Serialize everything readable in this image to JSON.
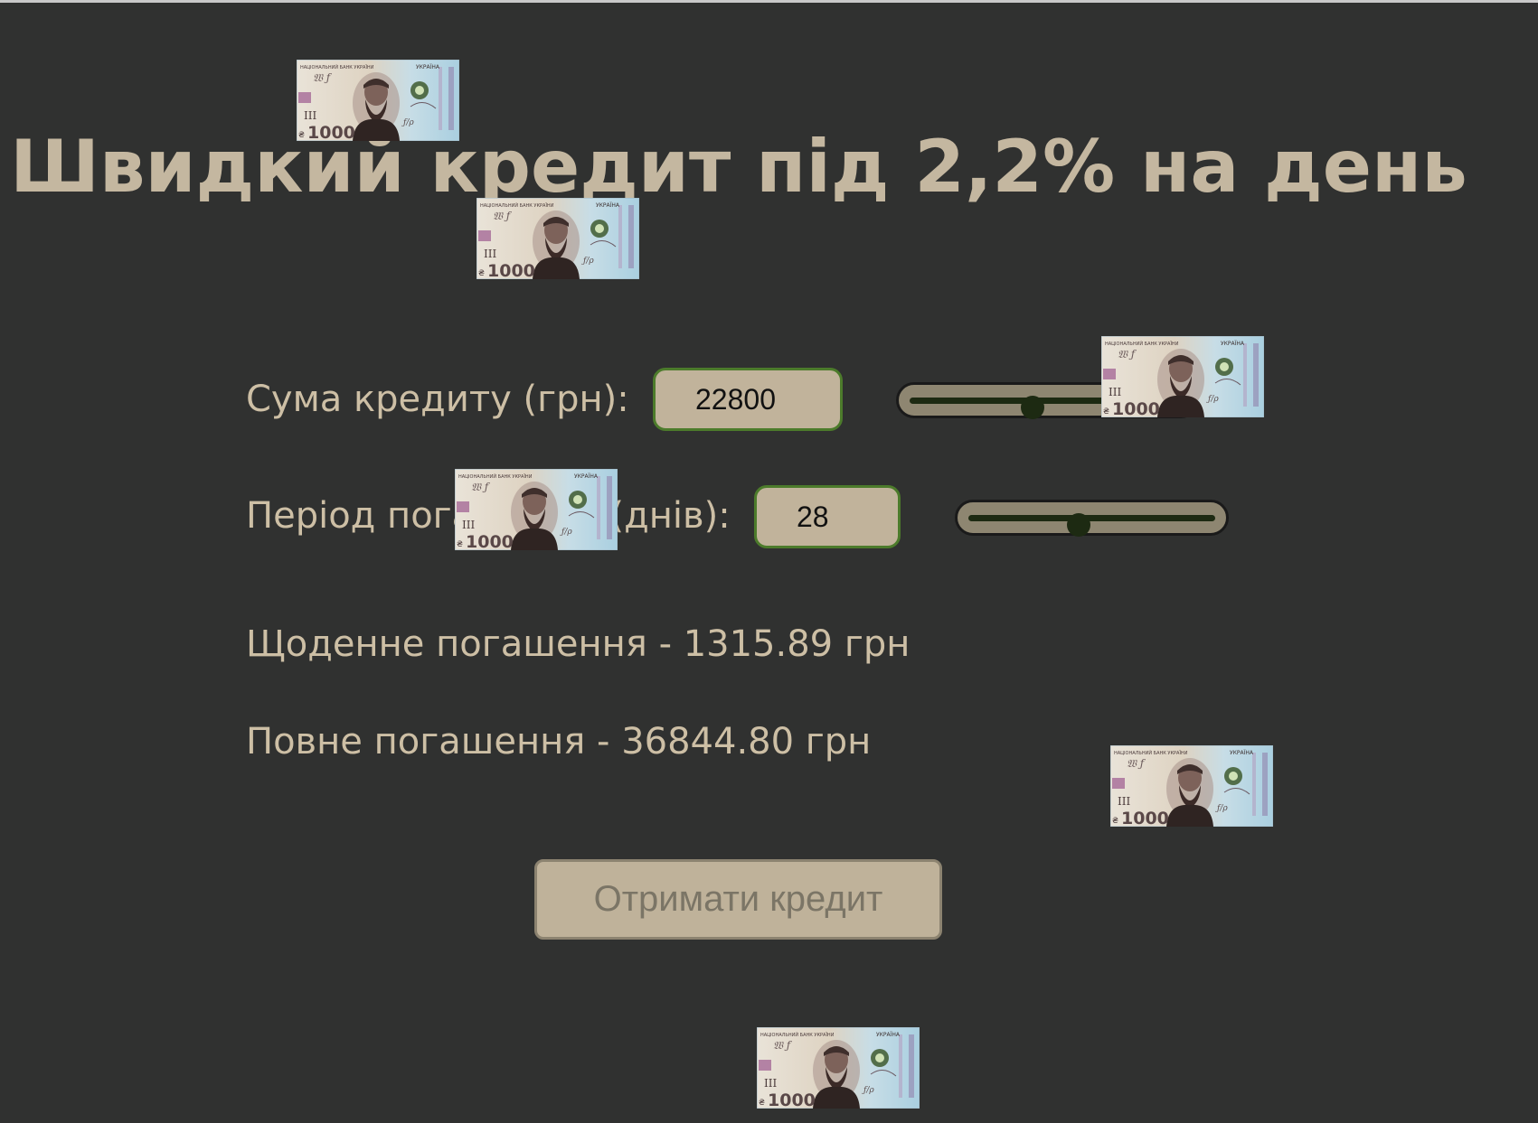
{
  "title": "Швидкий кредит під 2,2% на день",
  "loan_amount": {
    "label": "Сума кредиту (грн):",
    "value": "22800",
    "slider_fraction": 0.45
  },
  "period": {
    "label": "Період погашення (днів):",
    "value": "28",
    "slider_fraction": 0.45
  },
  "results": {
    "daily": "Щоденне погашення - 1315.89 грн",
    "total": "Повне погашення - 36844.80 грн"
  },
  "cta": {
    "label": "Отримати кредит"
  },
  "banknote": {
    "denomination": "1000",
    "currency_mark": "₴",
    "country": "УКРАЇНА",
    "bank": "НАЦІОНАЛЬНИЙ БАНК УКРАЇНИ"
  },
  "colors": {
    "background": "#303130",
    "text": "#cdbfa5",
    "input_border": "#4c7b2b",
    "input_fill": "#c1b39b"
  }
}
